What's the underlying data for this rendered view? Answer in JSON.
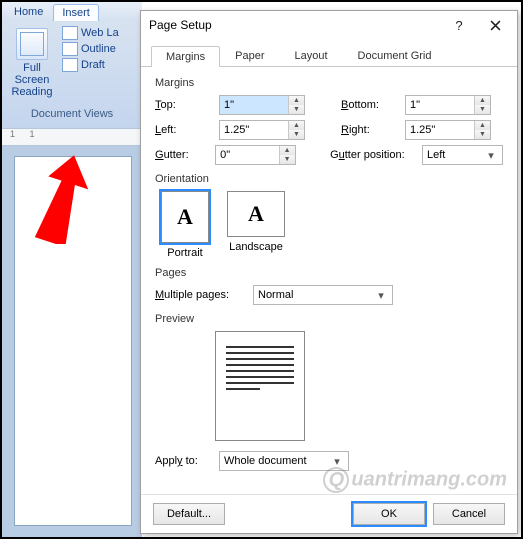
{
  "ribbon": {
    "tabs": [
      "Home",
      "Insert"
    ],
    "fullscreen_label": "Full Screen Reading",
    "weblayout": "Web La",
    "outline": "Outline",
    "draft": "Draft",
    "group": "Document Views"
  },
  "ruler_marks": "1        1",
  "dialog": {
    "title": "Page Setup",
    "tabs": {
      "margins": "Margins",
      "paper": "Paper",
      "layout": "Layout",
      "grid": "Document Grid"
    },
    "margins": {
      "section": "Margins",
      "top_label": "Top:",
      "top": "1\"",
      "bottom_label": "Bottom:",
      "bottom": "1\"",
      "left_label": "Left:",
      "left": "1.25\"",
      "right_label": "Right:",
      "right": "1.25\"",
      "gutter_label": "Gutter:",
      "gutter": "0\"",
      "gutterpos_label": "Gutter position:",
      "gutterpos": "Left"
    },
    "orientation": {
      "section": "Orientation",
      "portrait": "Portrait",
      "landscape": "Landscape"
    },
    "pages": {
      "section": "Pages",
      "multipages_label": "Multiple pages:",
      "multipages": "Normal"
    },
    "preview": {
      "section": "Preview"
    },
    "apply": {
      "label": "Apply to:",
      "value": "Whole document"
    },
    "buttons": {
      "default": "Default...",
      "ok": "OK",
      "cancel": "Cancel"
    }
  },
  "watermark": "uantrimang.com"
}
